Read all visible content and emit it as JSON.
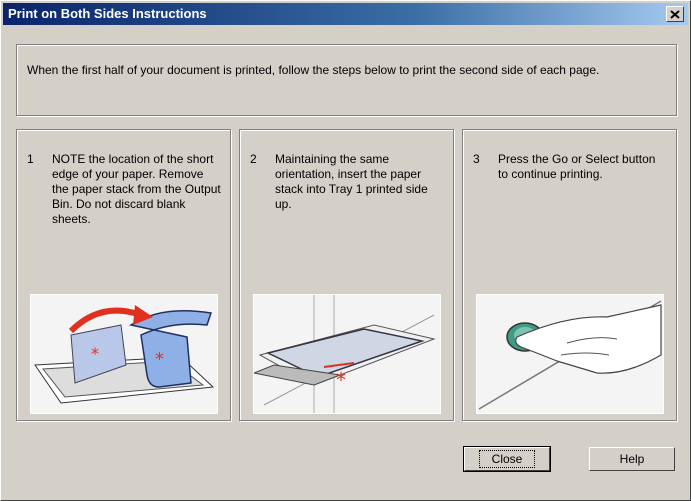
{
  "window": {
    "title": "Print on Both Sides Instructions"
  },
  "intro": {
    "text": "When the first half of your document is printed, follow the steps below to print the second side of each page."
  },
  "steps": [
    {
      "number": "1",
      "text": "NOTE the location of the short edge of your paper. Remove the  paper stack from the Output Bin.  Do not discard blank sheets."
    },
    {
      "number": "2",
      "text": "Maintaining the same orientation, insert the paper stack into Tray 1 printed side up."
    },
    {
      "number": "3",
      "text": "Press the Go or Select button to continue printing."
    }
  ],
  "buttons": {
    "close": "Close",
    "help": "Help"
  },
  "icons": {
    "close": "close-icon",
    "step1": "paper-flip-illustration",
    "step2": "tray-insert-illustration",
    "step3": "go-button-press-illustration"
  }
}
